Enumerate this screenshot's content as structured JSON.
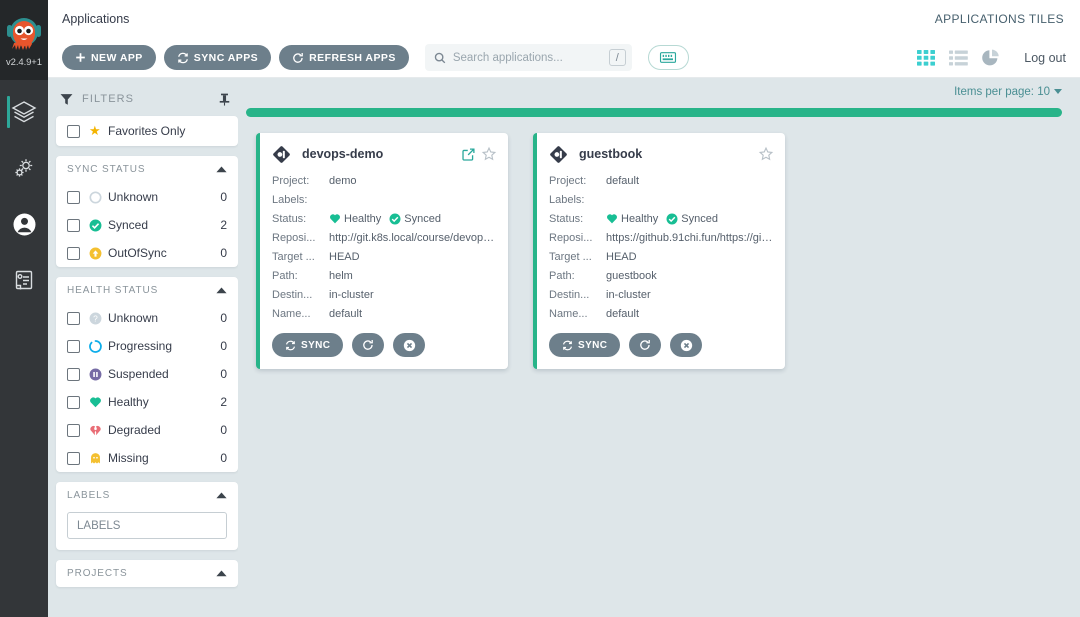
{
  "brand": {
    "logo_icon": "argo-octopus-logo",
    "version": "v2.4.9+1"
  },
  "nav": {
    "items": [
      {
        "icon": "layers-icon",
        "name": "applications",
        "active": true
      },
      {
        "icon": "gears-icon",
        "name": "settings",
        "active": false
      },
      {
        "icon": "user-circle-icon",
        "name": "user-info",
        "active": false
      },
      {
        "icon": "documentation-book-icon",
        "name": "documentation",
        "active": false
      }
    ]
  },
  "titlebar": {
    "title": "Applications",
    "view_label": "APPLICATIONS TILES"
  },
  "toolbar": {
    "new_app_label": "NEW APP",
    "sync_apps_label": "SYNC APPS",
    "refresh_apps_label": "REFRESH APPS",
    "search_placeholder": "Search applications...",
    "search_value": "",
    "search_shortcut": "/",
    "keyboard_button_icon": "keyboard-icon",
    "view_tiles_icon": "grid-tiles-icon",
    "view_list_icon": "list-icon",
    "view_pie_icon": "pie-chart-icon",
    "logout_label": "Log out",
    "accent_color": "#28b489",
    "active_view_color": "#3ccfd0"
  },
  "filters": {
    "title": "FILTERS",
    "pin_icon": "pin-icon",
    "favorites": {
      "label": "Favorites Only",
      "icon": "star-filled-icon",
      "checked": false
    },
    "sections": [
      {
        "title": "SYNC STATUS",
        "collapsed": false,
        "rows": [
          {
            "label": "Unknown",
            "count": "0",
            "icon": "circle-outline-icon",
            "color": "#ccd6dd"
          },
          {
            "label": "Synced",
            "count": "2",
            "icon": "check-circle-icon",
            "color": "#18be94"
          },
          {
            "label": "OutOfSync",
            "count": "0",
            "icon": "arrow-up-circle-icon",
            "color": "#f4c030"
          }
        ]
      },
      {
        "title": "HEALTH STATUS",
        "collapsed": false,
        "rows": [
          {
            "label": "Unknown",
            "count": "0",
            "icon": "question-circle-icon",
            "color": "#ccd6dd"
          },
          {
            "label": "Progressing",
            "count": "0",
            "icon": "spinner-circle-icon",
            "color": "#0dadea"
          },
          {
            "label": "Suspended",
            "count": "0",
            "icon": "pause-circle-icon",
            "color": "#766ca5"
          },
          {
            "label": "Healthy",
            "count": "2",
            "icon": "heart-icon",
            "color": "#18be94"
          },
          {
            "label": "Degraded",
            "count": "0",
            "icon": "heart-broken-icon",
            "color": "#e96d76"
          },
          {
            "label": "Missing",
            "count": "0",
            "icon": "ghost-icon",
            "color": "#f4c030"
          }
        ]
      }
    ],
    "labels_section": {
      "title": "LABELS",
      "input_placeholder": "LABELS",
      "input_value": ""
    },
    "projects_section": {
      "title": "PROJECTS"
    }
  },
  "content": {
    "items_per_page_label": "Items per page: 10",
    "health_bar_color": "#28b489"
  },
  "apps": [
    {
      "name": "devops-demo",
      "app_icon": "argo-app-icon",
      "has_external_link": true,
      "external_link_icon": "external-link-icon",
      "favorite_icon": "star-outline-icon",
      "rows": [
        {
          "key": "Project:",
          "value": "demo"
        },
        {
          "key": "Labels:",
          "value": ""
        },
        {
          "key": "Target ...",
          "value": "HEAD"
        },
        {
          "key": "Path:",
          "value": "helm"
        },
        {
          "key": "Destin...",
          "value": "in-cluster"
        },
        {
          "key": "Name...",
          "value": "default"
        }
      ],
      "status_key": "Status:",
      "health": "Healthy",
      "sync": "Synced",
      "repo_key": "Reposi...",
      "repo_value": "http://git.k8s.local/course/devops-...",
      "actions": {
        "sync_label": "SYNC",
        "sync_icon": "sync-icon",
        "refresh_icon": "refresh-icon",
        "delete_icon": "delete-circle-icon"
      }
    },
    {
      "name": "guestbook",
      "app_icon": "argo-app-icon",
      "has_external_link": false,
      "external_link_icon": "external-link-icon",
      "favorite_icon": "star-outline-icon",
      "rows": [
        {
          "key": "Project:",
          "value": "default"
        },
        {
          "key": "Labels:",
          "value": ""
        },
        {
          "key": "Target ...",
          "value": "HEAD"
        },
        {
          "key": "Path:",
          "value": "guestbook"
        },
        {
          "key": "Destin...",
          "value": "in-cluster"
        },
        {
          "key": "Name...",
          "value": "default"
        }
      ],
      "status_key": "Status:",
      "health": "Healthy",
      "sync": "Synced",
      "repo_key": "Reposi...",
      "repo_value": "https://github.91chi.fun/https://git...",
      "actions": {
        "sync_label": "SYNC",
        "sync_icon": "sync-icon",
        "refresh_icon": "refresh-icon",
        "delete_icon": "delete-circle-icon"
      }
    }
  ]
}
